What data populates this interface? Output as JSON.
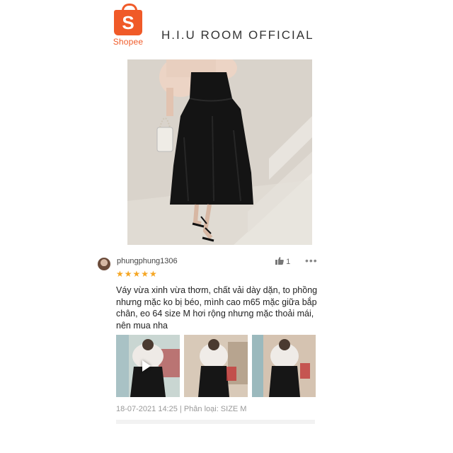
{
  "header": {
    "logo_text": "Shopee",
    "logo_letter": "S",
    "shop_name": "H.I.U ROOM OFFICIAL",
    "brand_color": "#f05a28"
  },
  "review": {
    "username": "phungphung1306",
    "stars": "★★★★★",
    "rating": 5,
    "likes": "1",
    "more": "•••",
    "comment": "Váy vừa xinh vừa thơm, chất vải dày dặn, to phồng nhưng mặc ko bị béo, mình cao m65 mặc giữa bắp chân, eo 64 size M hơi rộng nhưng mặc thoải mái, nên mua nha",
    "meta": "18-07-2021 14:25 | Phân loại: SIZE M",
    "star_color": "#f5a623"
  },
  "icons": {
    "like": "thumbs-up-icon",
    "more": "more-icon",
    "play": "play-icon"
  }
}
